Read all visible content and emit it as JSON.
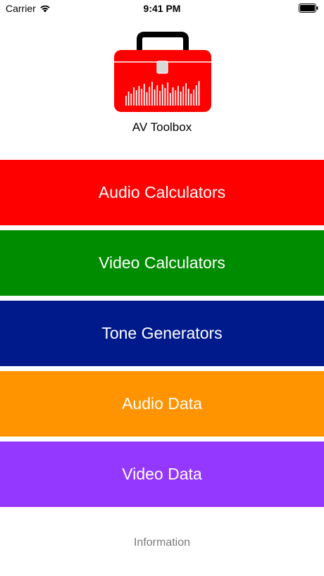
{
  "status_bar": {
    "carrier": "Carrier",
    "time": "9:41 PM",
    "wifi_icon": "wifi-icon",
    "battery_icon": "battery-icon"
  },
  "app": {
    "title": "AV Toolbox",
    "logo_icon": "toolbox-icon",
    "logo_color": "#ff0000"
  },
  "menu": [
    {
      "label": "Audio Calculators",
      "color": "#ff0000"
    },
    {
      "label": "Video Calculators",
      "color": "#008c00"
    },
    {
      "label": "Tone Generators",
      "color": "#001a8c"
    },
    {
      "label": "Audio Data",
      "color": "#ff9400"
    },
    {
      "label": "Video Data",
      "color": "#9438ff"
    }
  ],
  "footer": {
    "info_label": "Information"
  }
}
